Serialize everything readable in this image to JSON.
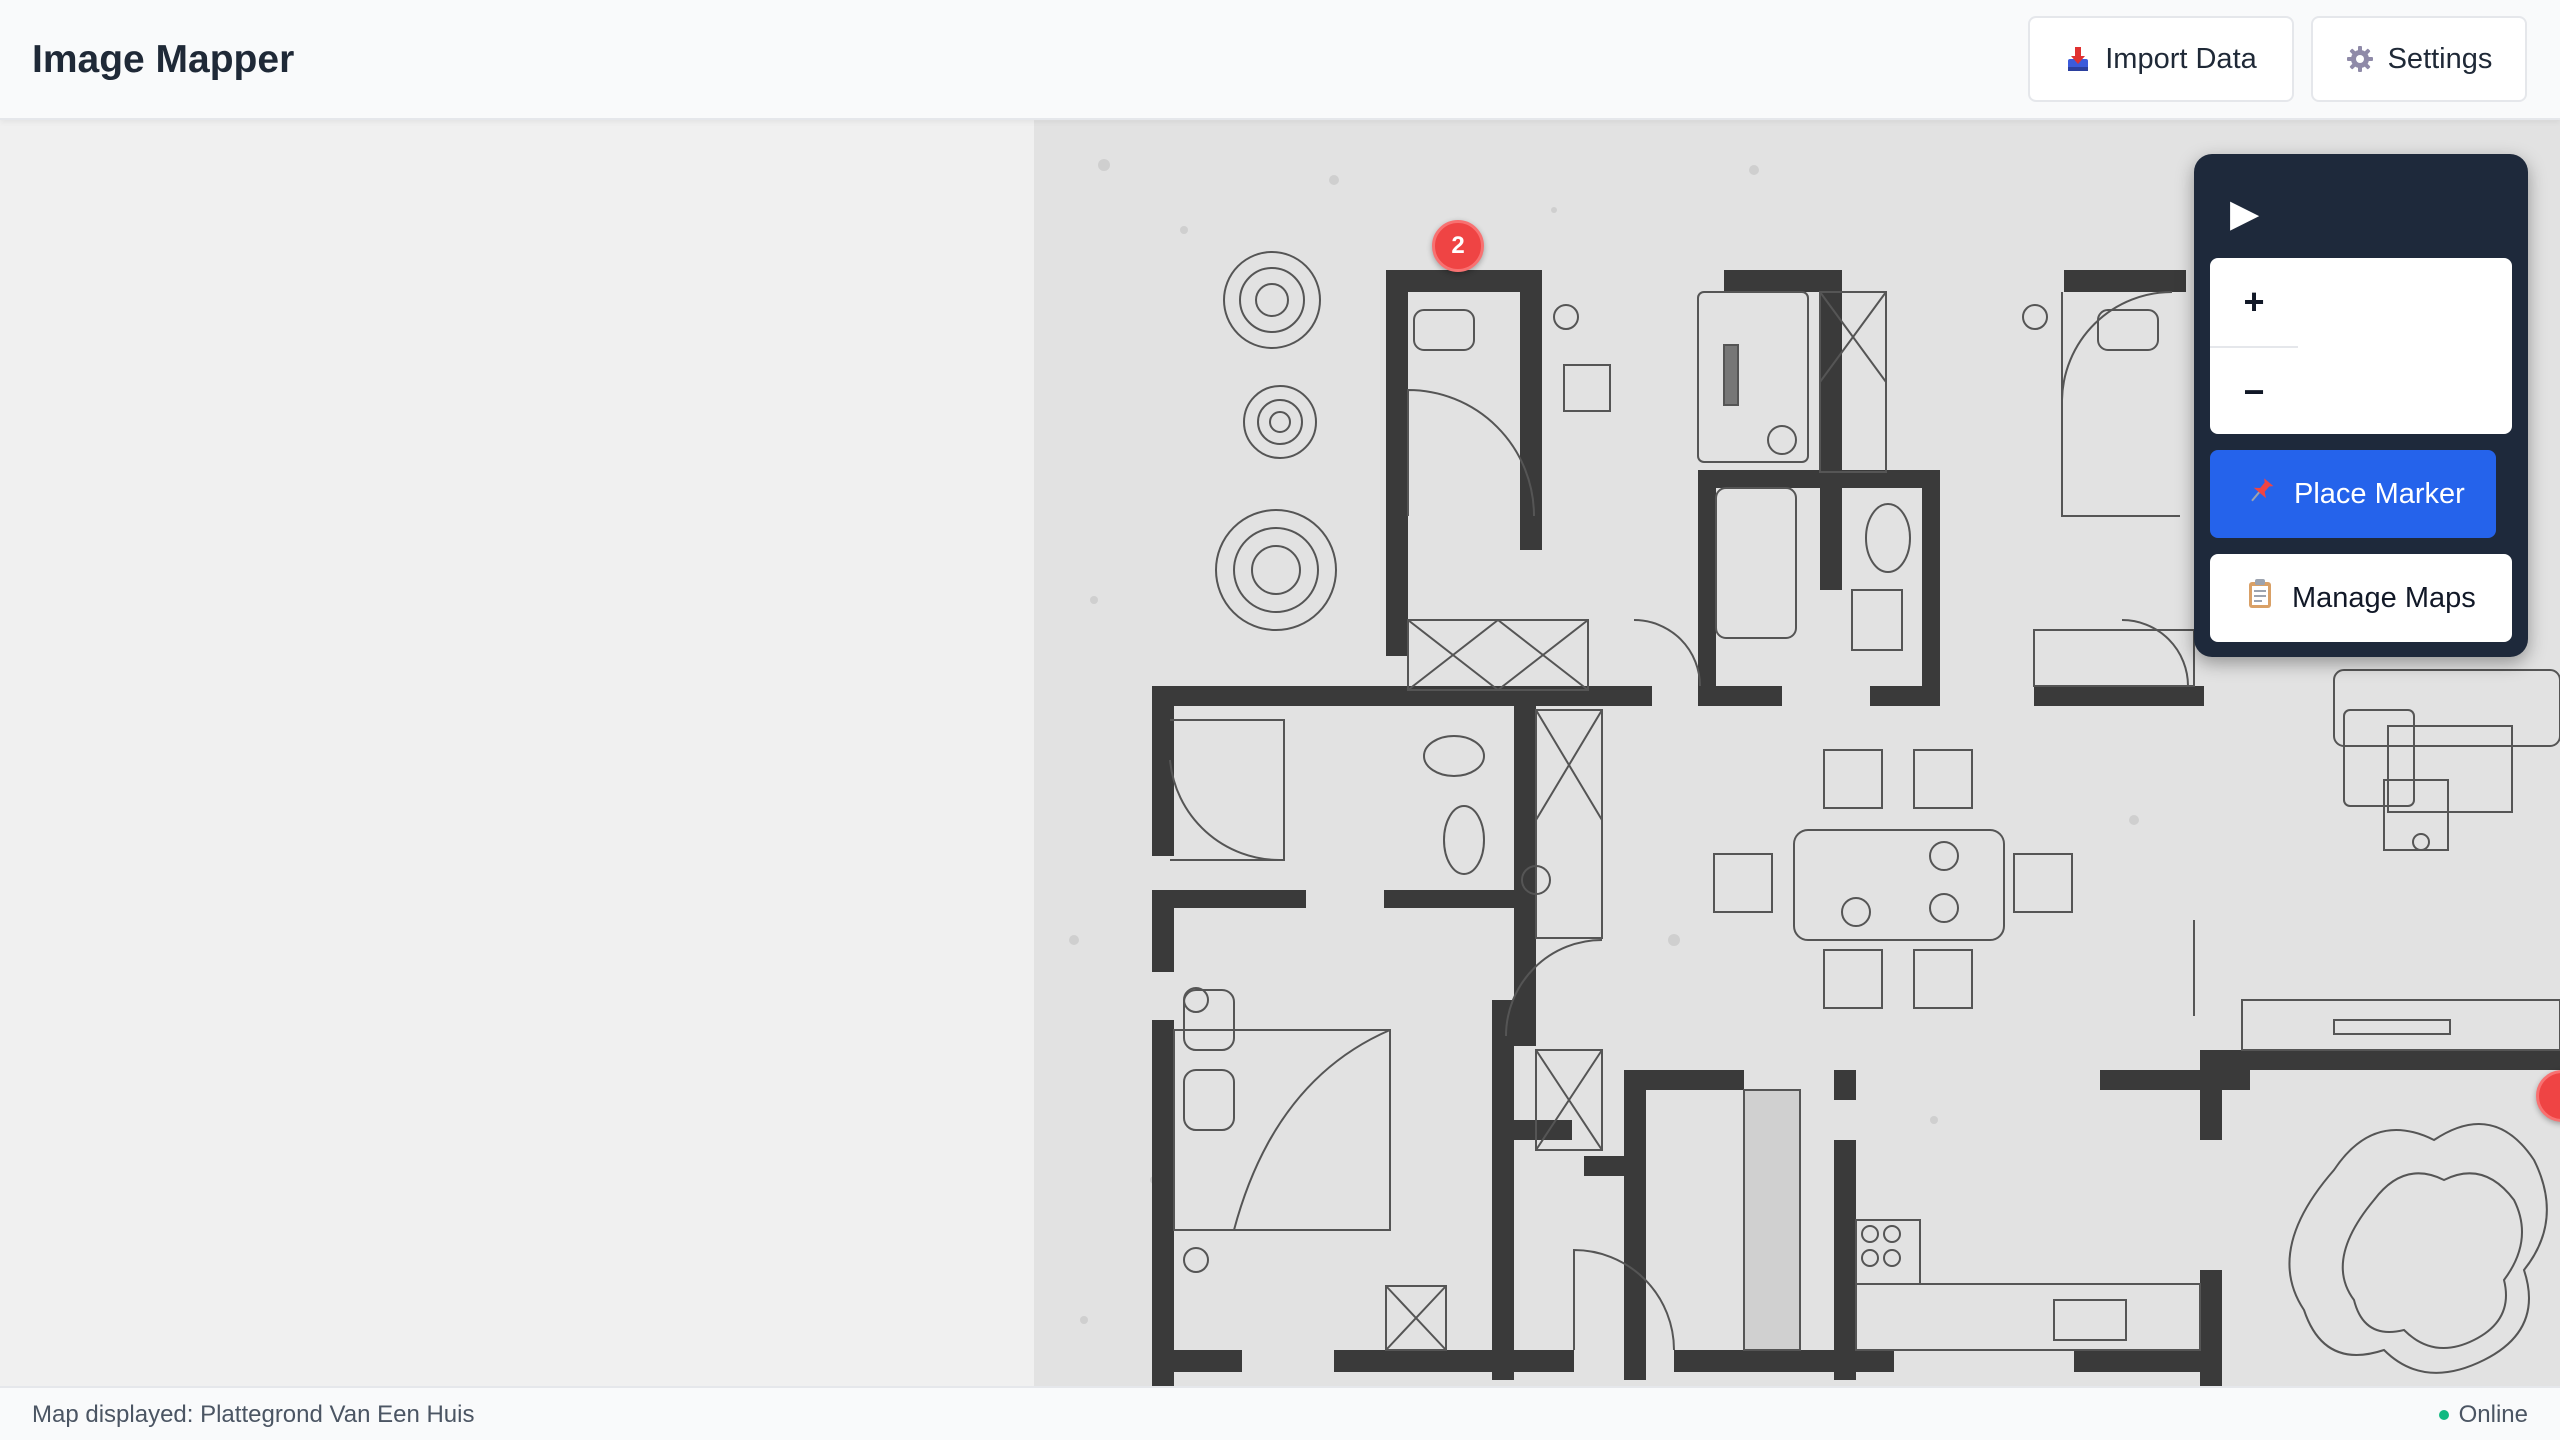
{
  "header": {
    "title": "Image Mapper",
    "import_label": "Import Data",
    "import_icon": "import-tray-icon",
    "settings_label": "Settings",
    "settings_icon": "gear-icon"
  },
  "map": {
    "markers": [
      {
        "label": "2"
      },
      {
        "label": ""
      }
    ]
  },
  "controls": {
    "toggle_icon": "▶",
    "zoom_in": "+",
    "zoom_out": "−",
    "place_marker_label": "Place Marker",
    "place_marker_icon": "📌",
    "manage_maps_label": "Manage Maps",
    "manage_maps_icon": "📋"
  },
  "footer": {
    "status": "Map displayed: Plattegrond Van Een Huis",
    "online": "Online"
  },
  "colors": {
    "accent": "#2563eb",
    "panel_bg": "#1e293b",
    "marker": "#ef4444",
    "online": "#10b981"
  }
}
